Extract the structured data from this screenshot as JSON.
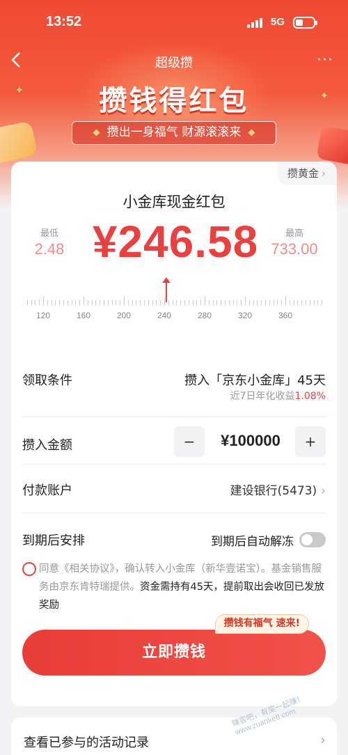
{
  "status_bar": {
    "time": "13:52",
    "network": "5G"
  },
  "nav": {
    "back_icon": "chevron-left-icon",
    "title": "超级攒",
    "more_icon": "more-icon"
  },
  "hero": {
    "headline": "攒钱得红包",
    "slogan": "攒出一身福气 财源滚滚来"
  },
  "card": {
    "gold_link": "攒黄金",
    "title": "小金库现金红包",
    "min_label": "最低",
    "min_value": "2.48",
    "amount": "¥246.58",
    "max_label": "最高",
    "max_value": "733.00",
    "ruler": {
      "labels": [
        "120",
        "160",
        "200",
        "240",
        "280",
        "320",
        "360"
      ],
      "current": 246.58
    }
  },
  "condition": {
    "label": "领取条件",
    "value": "攒入「京东小金库」45天",
    "sub_prefix": "近7日年化收益",
    "sub_rate": "1.08%"
  },
  "deposit": {
    "label": "攒入金额",
    "minus": "−",
    "value": "¥100000",
    "plus": "+"
  },
  "account": {
    "label": "付款账户",
    "value": "建设银行(5473)"
  },
  "expire": {
    "label": "到期后安排",
    "toggle_label": "到期后自动解冻",
    "toggle_on": false
  },
  "agreement": {
    "agree": "同意",
    "link": "《相关协议》",
    "part1": "，确认转入小金库（新华壹诺宝）。基金销售服务由京东肯特瑞提供。",
    "part2": "资金需持有45天，提前取出会收回已发放奖励"
  },
  "submit": {
    "label": "立即攒钱",
    "tag": "攒钱有福气 速来!"
  },
  "record": {
    "label": "查看已参与的活动记录"
  },
  "watermark": "赚客吧，有奖一起赚！ www.zuanke8.com",
  "colors": {
    "brand_red": "#e94040",
    "hero_red": "#f04a34"
  }
}
